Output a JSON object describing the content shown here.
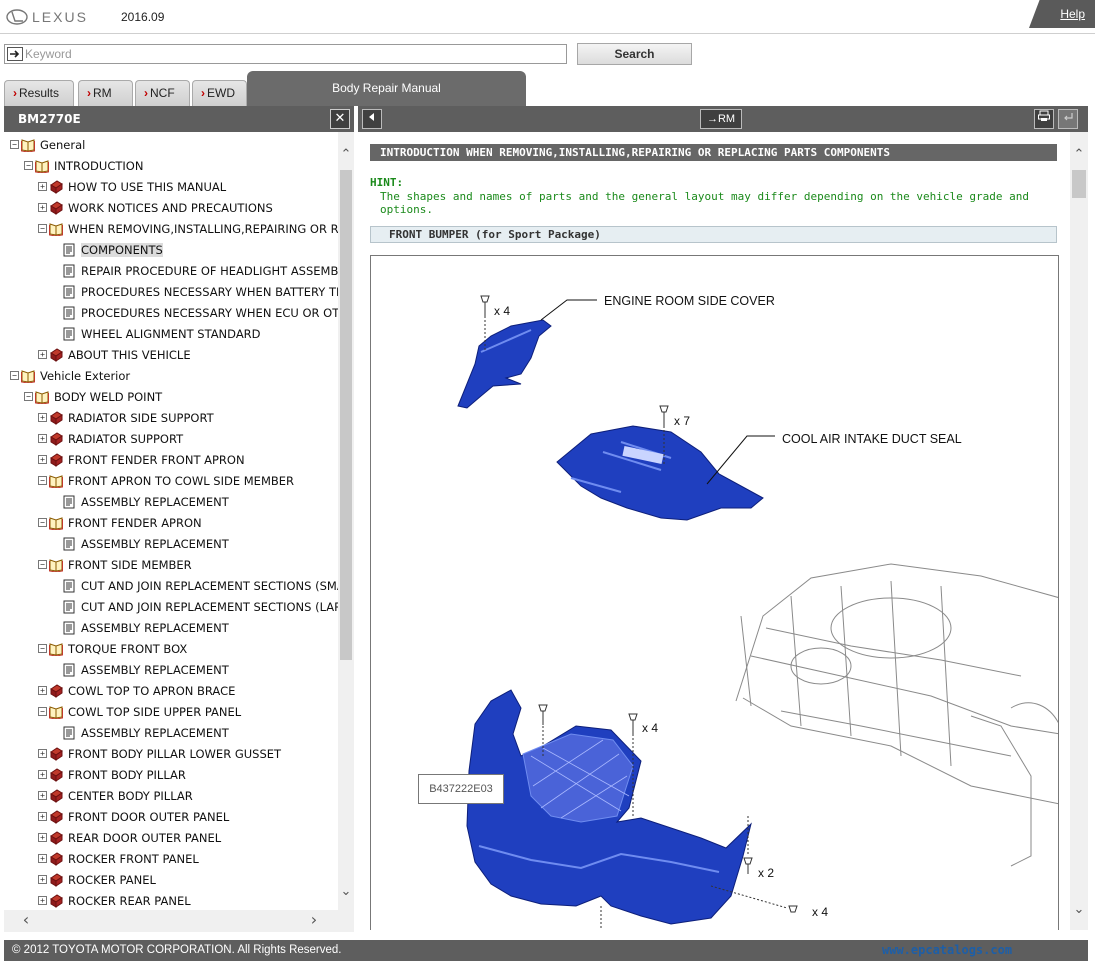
{
  "header": {
    "brand": "LEXUS",
    "version": "2016.09",
    "help": "Help"
  },
  "search": {
    "placeholder": "Keyword",
    "button": "Search"
  },
  "tabs": [
    {
      "label": "Results"
    },
    {
      "label": "RM"
    },
    {
      "label": "NCF"
    },
    {
      "label": "EWD"
    }
  ],
  "active_tab": "Body Repair Manual",
  "left_panel": {
    "title": "BM2770E",
    "close_glyph": "✕"
  },
  "tree": [
    {
      "label": "General",
      "level": 0,
      "toggle": "minus",
      "icon": "open-book"
    },
    {
      "label": "INTRODUCTION",
      "level": 1,
      "toggle": "minus",
      "icon": "open-book"
    },
    {
      "label": "HOW TO USE THIS MANUAL",
      "level": 2,
      "toggle": "plus",
      "icon": "closed-book"
    },
    {
      "label": "WORK NOTICES AND PRECAUTIONS",
      "level": 2,
      "toggle": "plus",
      "icon": "closed-book"
    },
    {
      "label": "WHEN REMOVING,INSTALLING,REPAIRING OR R",
      "level": 2,
      "toggle": "minus",
      "icon": "open-book"
    },
    {
      "label": "COMPONENTS",
      "level": 3,
      "toggle": "",
      "icon": "page",
      "selected": true
    },
    {
      "label": "REPAIR PROCEDURE OF HEADLIGHT ASSEMBLY",
      "level": 3,
      "toggle": "",
      "icon": "page"
    },
    {
      "label": "PROCEDURES NECESSARY WHEN BATTERY TERM",
      "level": 3,
      "toggle": "",
      "icon": "page"
    },
    {
      "label": "PROCEDURES NECESSARY WHEN ECU OR OTHER",
      "level": 3,
      "toggle": "",
      "icon": "page"
    },
    {
      "label": "WHEEL ALIGNMENT STANDARD",
      "level": 3,
      "toggle": "",
      "icon": "page"
    },
    {
      "label": "ABOUT THIS VEHICLE",
      "level": 2,
      "toggle": "plus",
      "icon": "closed-book"
    },
    {
      "label": "Vehicle Exterior",
      "level": 0,
      "toggle": "minus",
      "icon": "open-book"
    },
    {
      "label": "BODY WELD POINT",
      "level": 1,
      "toggle": "minus",
      "icon": "open-book"
    },
    {
      "label": "RADIATOR SIDE SUPPORT",
      "level": 2,
      "toggle": "plus",
      "icon": "closed-book"
    },
    {
      "label": "RADIATOR SUPPORT",
      "level": 2,
      "toggle": "plus",
      "icon": "closed-book"
    },
    {
      "label": "FRONT FENDER FRONT APRON",
      "level": 2,
      "toggle": "plus",
      "icon": "closed-book"
    },
    {
      "label": "FRONT APRON TO COWL SIDE MEMBER",
      "level": 2,
      "toggle": "minus",
      "icon": "open-book"
    },
    {
      "label": "ASSEMBLY REPLACEMENT",
      "level": 3,
      "toggle": "",
      "icon": "page"
    },
    {
      "label": "FRONT FENDER APRON",
      "level": 2,
      "toggle": "minus",
      "icon": "open-book"
    },
    {
      "label": "ASSEMBLY REPLACEMENT",
      "level": 3,
      "toggle": "",
      "icon": "page"
    },
    {
      "label": "FRONT SIDE MEMBER",
      "level": 2,
      "toggle": "minus",
      "icon": "open-book"
    },
    {
      "label": "CUT AND JOIN REPLACEMENT SECTIONS (SMALL",
      "level": 3,
      "toggle": "",
      "icon": "page"
    },
    {
      "label": "CUT AND JOIN REPLACEMENT SECTIONS (LARGE",
      "level": 3,
      "toggle": "",
      "icon": "page"
    },
    {
      "label": "ASSEMBLY REPLACEMENT",
      "level": 3,
      "toggle": "",
      "icon": "page"
    },
    {
      "label": "TORQUE FRONT BOX",
      "level": 2,
      "toggle": "minus",
      "icon": "open-book"
    },
    {
      "label": "ASSEMBLY REPLACEMENT",
      "level": 3,
      "toggle": "",
      "icon": "page"
    },
    {
      "label": "COWL TOP TO APRON BRACE",
      "level": 2,
      "toggle": "plus",
      "icon": "closed-book"
    },
    {
      "label": "COWL TOP SIDE UPPER PANEL",
      "level": 2,
      "toggle": "minus",
      "icon": "open-book"
    },
    {
      "label": "ASSEMBLY REPLACEMENT",
      "level": 3,
      "toggle": "",
      "icon": "page"
    },
    {
      "label": "FRONT BODY PILLAR LOWER GUSSET",
      "level": 2,
      "toggle": "plus",
      "icon": "closed-book"
    },
    {
      "label": "FRONT BODY PILLAR",
      "level": 2,
      "toggle": "plus",
      "icon": "closed-book"
    },
    {
      "label": "CENTER BODY PILLAR",
      "level": 2,
      "toggle": "plus",
      "icon": "closed-book"
    },
    {
      "label": "FRONT DOOR OUTER PANEL",
      "level": 2,
      "toggle": "plus",
      "icon": "closed-book"
    },
    {
      "label": "REAR DOOR OUTER PANEL",
      "level": 2,
      "toggle": "plus",
      "icon": "closed-book"
    },
    {
      "label": "ROCKER FRONT PANEL",
      "level": 2,
      "toggle": "plus",
      "icon": "closed-book"
    },
    {
      "label": "ROCKER PANEL",
      "level": 2,
      "toggle": "plus",
      "icon": "closed-book"
    },
    {
      "label": "ROCKER REAR PANEL",
      "level": 2,
      "toggle": "plus",
      "icon": "closed-book"
    }
  ],
  "toolbar": {
    "to_rm": "→RM"
  },
  "content": {
    "title": "INTRODUCTION  WHEN REMOVING,INSTALLING,REPAIRING OR REPLACING PARTS  COMPONENTS",
    "hint_label": "HINT:",
    "hint_text": "The shapes and names of parts and the general layout may differ depending on the vehicle grade and options.",
    "section": "FRONT BUMPER (for Sport Package)",
    "figure": {
      "callouts": [
        "ENGINE ROOM SIDE COVER",
        "COOL AIR INTAKE DUCT SEAL"
      ],
      "quantities": [
        "x 4",
        "x 7",
        "x 4",
        "x 2",
        "x 4"
      ],
      "figure_id": "B437222E03"
    }
  },
  "footer": {
    "copyright": "© 2012 TOYOTA MOTOR CORPORATION. All Rights Reserved.",
    "site": "www.epcatalogs.com"
  },
  "colors": {
    "toolbar_gray": "#5e5e5e",
    "part_blue": "#1f3fbf",
    "hint_green": "#1b8a1b",
    "tab_arrow_red": "#c00000"
  }
}
